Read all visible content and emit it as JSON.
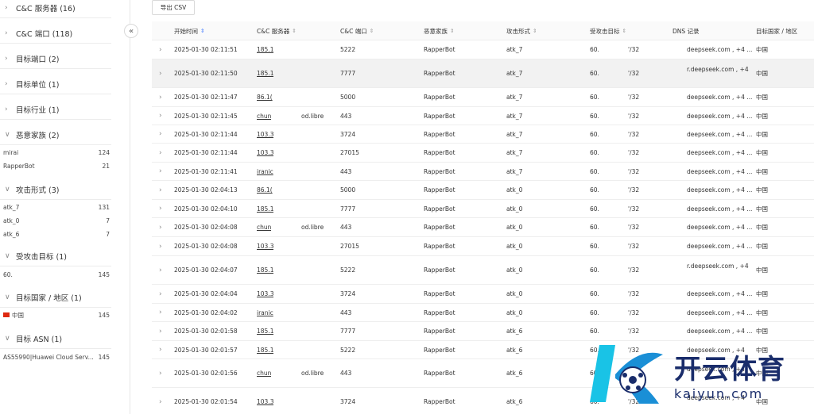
{
  "sidebar": {
    "collapse_label": "«",
    "sections": [
      {
        "title": "C&C 服务器 (16)",
        "expanded": false
      },
      {
        "title": "C&C 端口 (118)",
        "expanded": false
      },
      {
        "title": "目标端口 (2)",
        "expanded": false
      },
      {
        "title": "目标单位 (1)",
        "expanded": false
      },
      {
        "title": "目标行业 (1)",
        "expanded": false
      },
      {
        "title": "恶意家族 (2)",
        "expanded": true,
        "items": [
          {
            "label": "mirai",
            "count": "124"
          },
          {
            "label": "RapperBot",
            "count": "21"
          }
        ]
      },
      {
        "title": "攻击形式 (3)",
        "expanded": true,
        "items": [
          {
            "label": "atk_7",
            "count": "131"
          },
          {
            "label": "atk_0",
            "count": "7"
          },
          {
            "label": "atk_6",
            "count": "7"
          }
        ]
      },
      {
        "title": "受攻击目标 (1)",
        "expanded": true,
        "items": [
          {
            "label": "60.",
            "count": "145"
          }
        ]
      },
      {
        "title": "目标国家 / 地区 (1)",
        "expanded": true,
        "items": [
          {
            "label": "中国",
            "count": "145",
            "flag": true
          }
        ]
      },
      {
        "title": "目标 ASN (1)",
        "expanded": true,
        "items": [
          {
            "label": "AS55990|Huawei Cloud Serv...",
            "count": "145"
          }
        ]
      }
    ]
  },
  "toolbar": {
    "export_label": "导出 CSV"
  },
  "table": {
    "headers": [
      "开始时间",
      "C&C 服务器",
      "C&C 端口",
      "恶意家族",
      "攻击形式",
      "受攻击目标",
      "DNS 记录",
      "目标国家 / 地区"
    ],
    "rows": [
      {
        "time": "2025-01-30 02:11:51",
        "cc": "185.1",
        "cc2": "",
        "port": "5222",
        "family": "RapperBot",
        "atk": "atk_7",
        "target": "60.",
        "target2": "'/32",
        "dns": "deepseek.com , +4 ...",
        "country": "中国"
      },
      {
        "time": "2025-01-30 02:11:50",
        "cc": "185.1",
        "cc2": "",
        "port": "7777",
        "family": "RapperBot",
        "atk": "atk_7",
        "target": "60.",
        "target2": "'/32",
        "dns": "r.deepseek.com , +4",
        "country": "中国"
      },
      {
        "time": "2025-01-30 02:11:47",
        "cc": "86.1(",
        "cc2": "",
        "port": "5000",
        "family": "RapperBot",
        "atk": "atk_7",
        "target": "60.",
        "target2": "'/32",
        "dns": "deepseek.com , +4 ...",
        "country": "中国"
      },
      {
        "time": "2025-01-30 02:11:45",
        "cc": "chun",
        "cc2": "od.libre",
        "port": "443",
        "family": "RapperBot",
        "atk": "atk_7",
        "target": "60.",
        "target2": "'/32",
        "dns": "deepseek.com , +4 ...",
        "country": "中国"
      },
      {
        "time": "2025-01-30 02:11:44",
        "cc": "103.3",
        "cc2": "",
        "port": "3724",
        "family": "RapperBot",
        "atk": "atk_7",
        "target": "60.",
        "target2": "'/32",
        "dns": "deepseek.com , +4 ...",
        "country": "中国"
      },
      {
        "time": "2025-01-30 02:11:44",
        "cc": "103.3",
        "cc2": "",
        "port": "27015",
        "family": "RapperBot",
        "atk": "atk_7",
        "target": "60.",
        "target2": "'/32",
        "dns": "deepseek.com , +4 ...",
        "country": "中国"
      },
      {
        "time": "2025-01-30 02:11:41",
        "cc": "iranic",
        "cc2": "",
        "port": "443",
        "family": "RapperBot",
        "atk": "atk_7",
        "target": "60.",
        "target2": "'/32",
        "dns": "deepseek.com , +4 ...",
        "country": "中国"
      },
      {
        "time": "2025-01-30 02:04:13",
        "cc": "86.1(",
        "cc2": "",
        "port": "5000",
        "family": "RapperBot",
        "atk": "atk_0",
        "target": "60.",
        "target2": "'/32",
        "dns": "deepseek.com , +4 ...",
        "country": "中国"
      },
      {
        "time": "2025-01-30 02:04:10",
        "cc": "185.1",
        "cc2": "",
        "port": "7777",
        "family": "RapperBot",
        "atk": "atk_0",
        "target": "60.",
        "target2": "'/32",
        "dns": "deepseek.com , +4 ...",
        "country": "中国"
      },
      {
        "time": "2025-01-30 02:04:08",
        "cc": "chun",
        "cc2": "od.libre",
        "port": "443",
        "family": "RapperBot",
        "atk": "atk_0",
        "target": "60.",
        "target2": "'/32",
        "dns": "deepseek.com , +4 ...",
        "country": "中国"
      },
      {
        "time": "2025-01-30 02:04:08",
        "cc": "103.3",
        "cc2": "",
        "port": "27015",
        "family": "RapperBot",
        "atk": "atk_0",
        "target": "60.",
        "target2": "'/32",
        "dns": "deepseek.com , +4 ...",
        "country": "中国"
      },
      {
        "time": "2025-01-30 02:04:07",
        "cc": "185.1",
        "cc2": "",
        "port": "5222",
        "family": "RapperBot",
        "atk": "atk_0",
        "target": "60.",
        "target2": "'/32",
        "dns": "r.deepseek.com , +4",
        "country": "中国"
      },
      {
        "time": "2025-01-30 02:04:04",
        "cc": "103.3",
        "cc2": "",
        "port": "3724",
        "family": "RapperBot",
        "atk": "atk_0",
        "target": "60.",
        "target2": "'/32",
        "dns": "deepseek.com , +4 ...",
        "country": "中国"
      },
      {
        "time": "2025-01-30 02:04:02",
        "cc": "iranic",
        "cc2": "",
        "port": "443",
        "family": "RapperBot",
        "atk": "atk_0",
        "target": "60.",
        "target2": "'/32",
        "dns": "deepseek.com , +4 ...",
        "country": "中国"
      },
      {
        "time": "2025-01-30 02:01:58",
        "cc": "185.1",
        "cc2": "",
        "port": "7777",
        "family": "RapperBot",
        "atk": "atk_6",
        "target": "60.",
        "target2": "'/32",
        "dns": "deepseek.com , +4 ...",
        "country": "中国"
      },
      {
        "time": "2025-01-30 02:01:57",
        "cc": "185.1",
        "cc2": "",
        "port": "5222",
        "family": "RapperBot",
        "atk": "atk_6",
        "target": "60.",
        "target2": "'/32",
        "dns": "deepseek.com , +4",
        "country": "中国"
      },
      {
        "time": "2025-01-30 02:01:56",
        "cc": "chun",
        "cc2": "od.libre",
        "port": "443",
        "family": "RapperBot",
        "atk": "atk_6",
        "target": "60.",
        "target2": "'/32",
        "dns": "deepseek.com , +4",
        "country": "中国"
      },
      {
        "time": "2025-01-30 02:01:54",
        "cc": "103.3",
        "cc2": "",
        "port": "3724",
        "family": "RapperBot",
        "atk": "atk_6",
        "target": "60.",
        "target2": "'/32",
        "dns": "deepseek.com , +4",
        "country": "中国"
      }
    ]
  },
  "watermark": {
    "cn": "开云体育",
    "en": "kaiyun.com"
  },
  "colors": {
    "accent": "#3370ff",
    "border": "#e6e6e6",
    "highlight_row": "#f2f2f2",
    "watermark_blue": "#1a2d6b",
    "watermark_cyan": "#19c3e6"
  }
}
